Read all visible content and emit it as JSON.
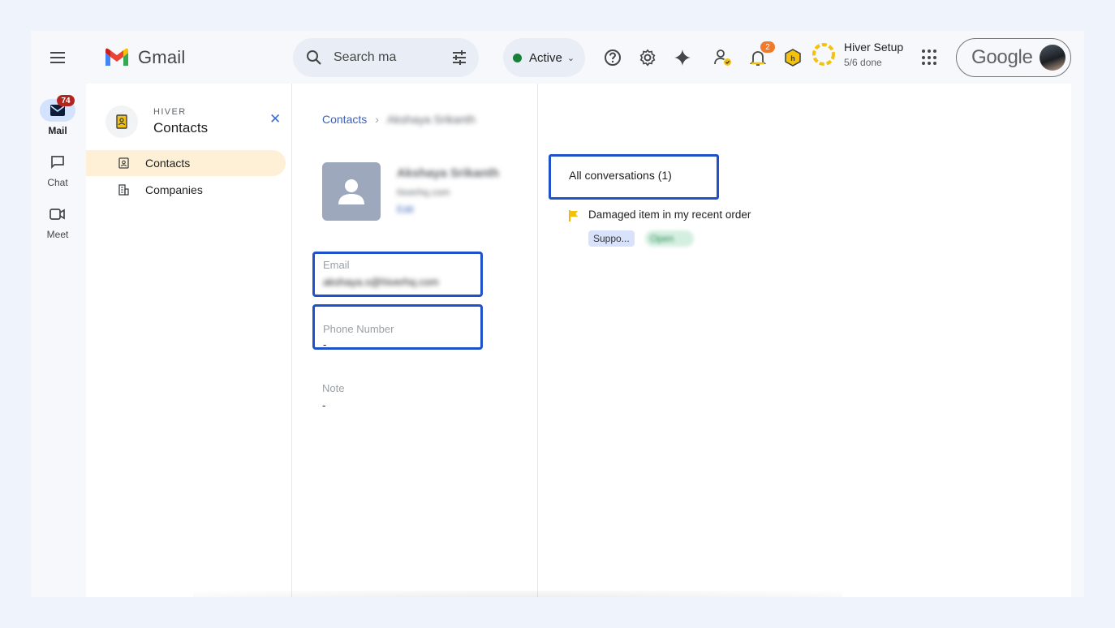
{
  "app": {
    "name": "Gmail",
    "colors": {
      "accent": "#1f52c9",
      "active_nav_bg": "#fef0d6",
      "status_green": "#188038",
      "mail_badge": "#b3261e"
    }
  },
  "topbar": {
    "search_placeholder": "Search ma",
    "status_label": "Active",
    "notifications_count": "2",
    "hiver_setup": {
      "title": "Hiver Setup",
      "progress": "5/6 done",
      "progress_fraction": 0.83
    },
    "account_brand": "Google",
    "icons": [
      "menu-icon",
      "search-icon",
      "filter-icon",
      "help-icon",
      "settings-icon",
      "gemini-icon",
      "user-check-icon",
      "bell-icon",
      "shield-icon",
      "apps-icon"
    ]
  },
  "rail": {
    "items": [
      {
        "label": "Mail",
        "badge": "74",
        "icon": "mail-icon",
        "active": true
      },
      {
        "label": "Chat",
        "icon": "chat-icon",
        "active": false
      },
      {
        "label": "Meet",
        "icon": "video-icon",
        "active": false
      }
    ]
  },
  "sidebar": {
    "brand": "HIVER",
    "title": "Contacts",
    "items": [
      {
        "label": "Contacts",
        "icon": "contact-card-icon",
        "active": true
      },
      {
        "label": "Companies",
        "icon": "building-icon",
        "active": false
      }
    ]
  },
  "contact": {
    "breadcrumb_root": "Contacts",
    "name": "Akshaya Srikanth",
    "handle": "hiverhq.com",
    "edit_link": "Edit",
    "email_label": "Email",
    "email_value": "akshaya.s@hiverhq.com",
    "phone_label": "Phone Number",
    "phone_value": "-",
    "note_label": "Note",
    "note_value": "-"
  },
  "conversations": {
    "tab_label": "All conversations (1)",
    "items": [
      {
        "subject": "Damaged item in my recent order",
        "tag": "Suppo...",
        "status": "Open"
      }
    ]
  }
}
